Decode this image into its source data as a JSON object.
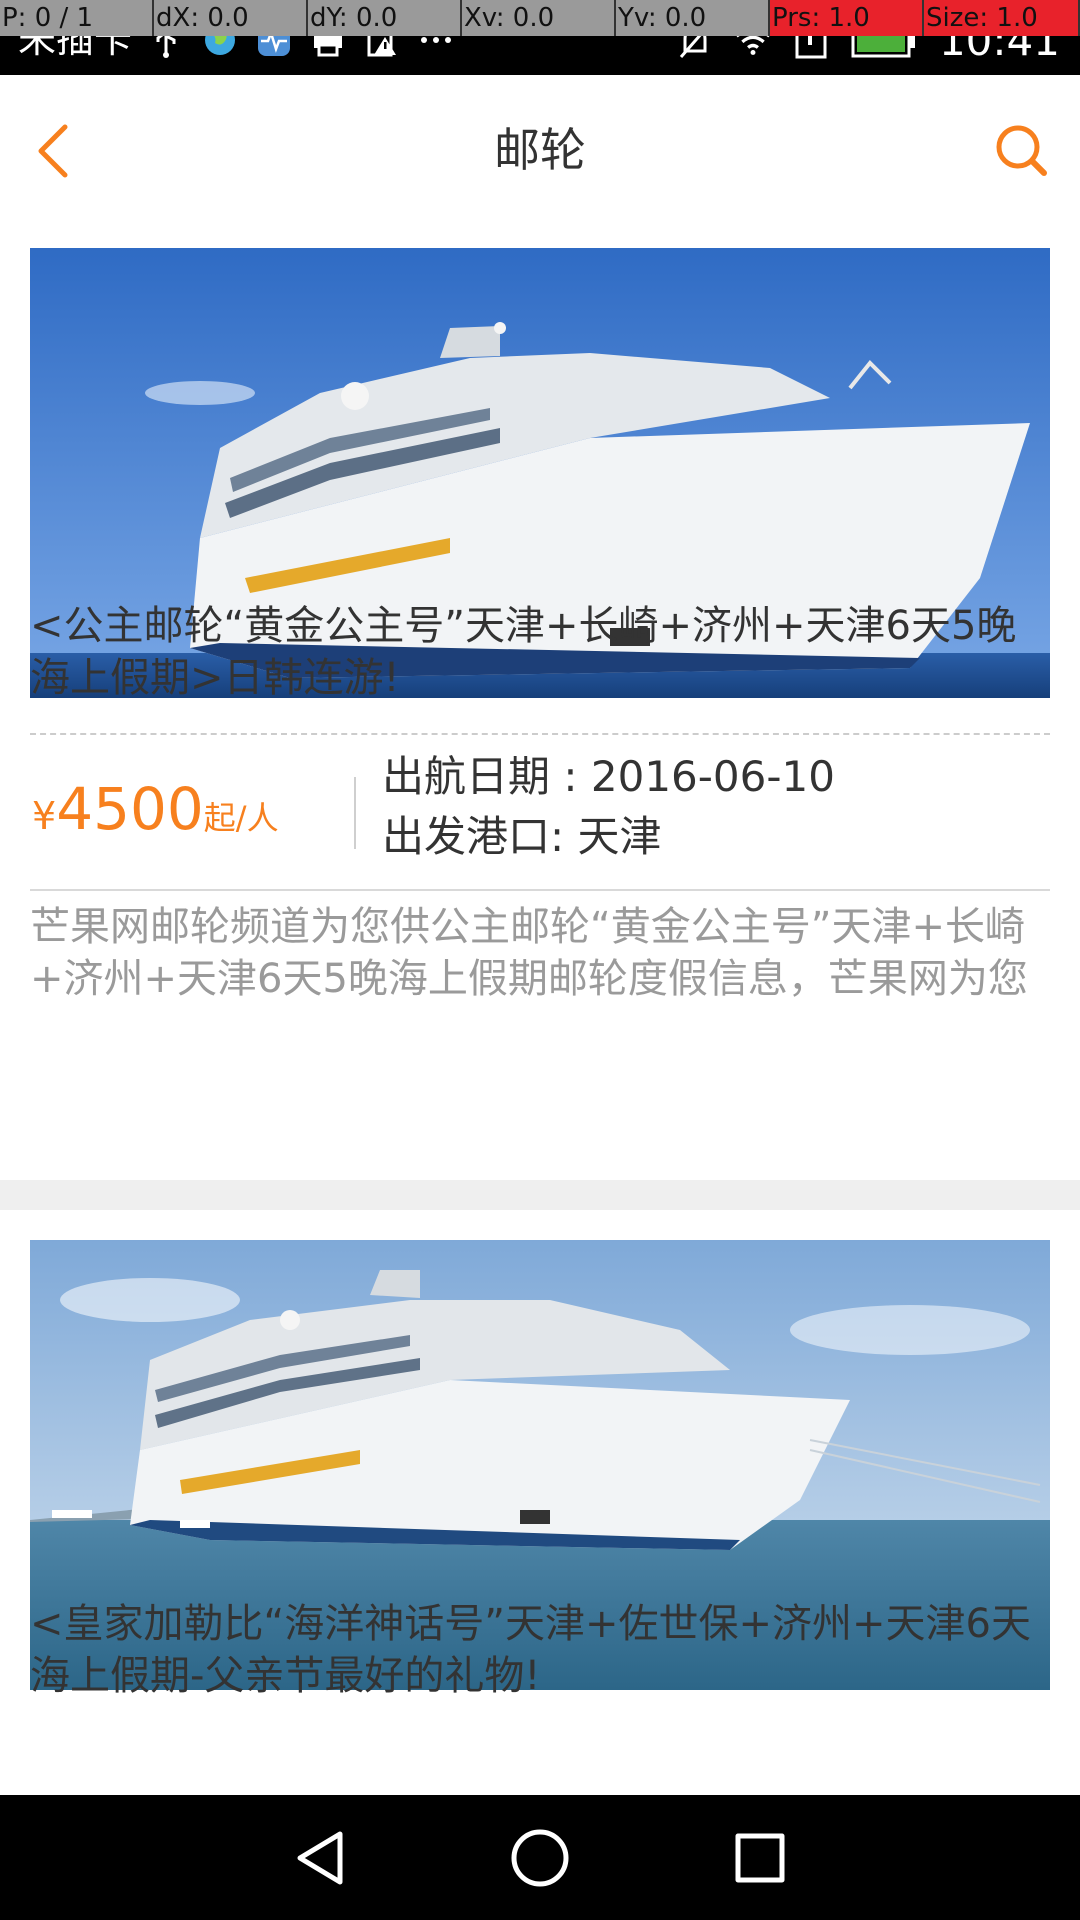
{
  "status_bar": {
    "carrier": "未插卡",
    "time": "10:41",
    "debug": {
      "pointer": "P: 0 / 1",
      "dx": "dX: 0.0",
      "dy": "dY: 0.0",
      "xv": "Xv: 0.0",
      "yv": "Yv: 0.0",
      "prs": "Prs: 1.0",
      "size": "Size: 1.0"
    },
    "left_icons": [
      "usb-icon",
      "globe-icon",
      "pulse-icon",
      "printer-icon",
      "alert-icon",
      "more-icon"
    ],
    "right_icons": [
      "mute-icon",
      "wifi-icon",
      "sim-icon",
      "battery-icon"
    ]
  },
  "header": {
    "title": "邮轮",
    "back_icon": "chevron-left-icon",
    "search_icon": "search-icon",
    "accent_color": "#f7801e"
  },
  "cruises": [
    {
      "title": "<公主邮轮“黄金公主号”天津+长崎+济州+天津6天5晚海上假期>日韩连游!",
      "currency": "¥",
      "price": "4500",
      "price_unit": "起/人",
      "departure_date_label": "出航日期",
      "departure_date_separator": " : ",
      "departure_date": "2016-06-10",
      "port_label": "出发港口:",
      "port": "天津",
      "description": "芒果网邮轮频道为您供公主邮轮“黄金公主号”天津+长崎+济州+天津6天5晚海上假期邮轮度假信息，芒果网为您"
    },
    {
      "title": "<皇家加勒比“海洋神话号”天津+佐世保+济州+天津6天海上假期-父亲节最好的礼物!"
    }
  ],
  "nav_bar": {
    "back": "triangle-back-icon",
    "home": "circle-home-icon",
    "recents": "square-recents-icon"
  }
}
